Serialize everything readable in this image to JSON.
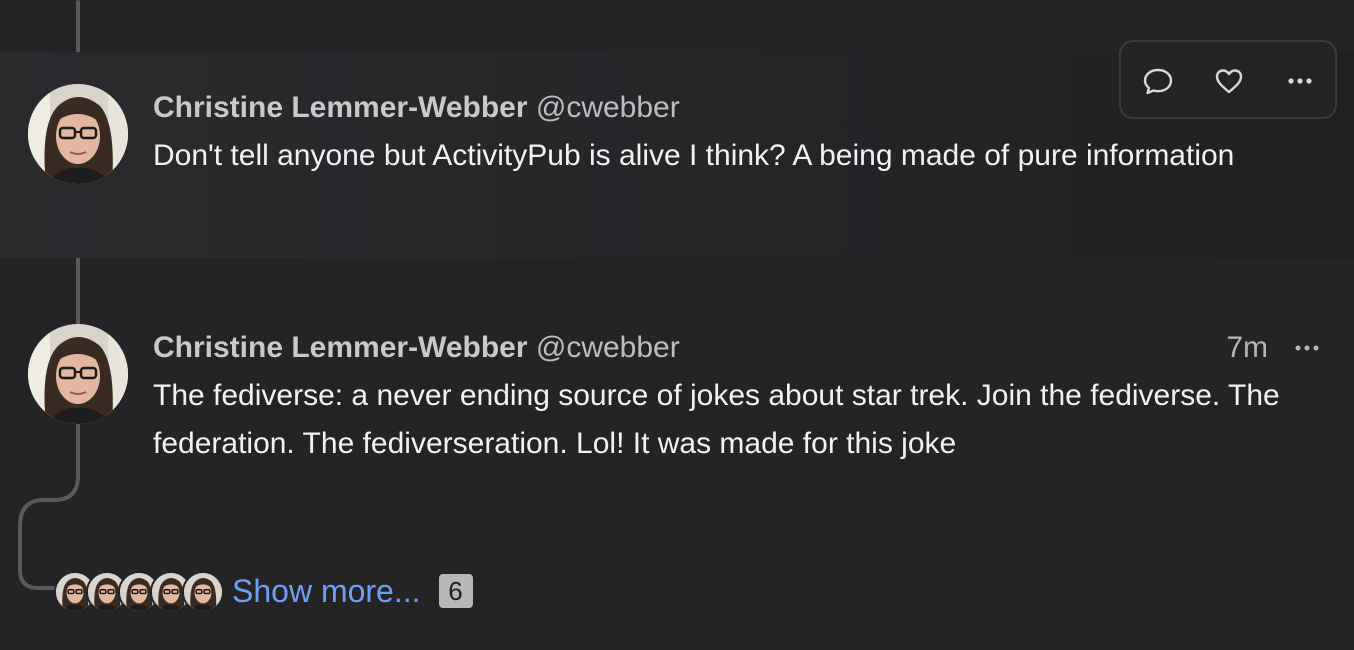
{
  "thread": {
    "posts": [
      {
        "display_name": "Christine Lemmer-Webber",
        "handle": "@cwebber",
        "content": "Don't tell anyone but ActivityPub is alive I think? A being made of pure information",
        "highlighted": true
      },
      {
        "display_name": "Christine Lemmer-Webber",
        "handle": "@cwebber",
        "timestamp": "7m",
        "content": "The fediverse: a never ending source of jokes about star trek. Join the fediverse. The federation. The fediverseration. Lol! It was made for this joke"
      }
    ],
    "toolbar": {
      "icons": [
        "reply-icon",
        "favourite-icon",
        "more-icon"
      ]
    },
    "show_more": {
      "label": "Show more...",
      "count": "6",
      "avatar_count": 5
    }
  },
  "colors": {
    "background": "#242426",
    "link": "#6f9ff5",
    "thread_line": "#5a5a5e",
    "text": "#f2f2f4"
  }
}
